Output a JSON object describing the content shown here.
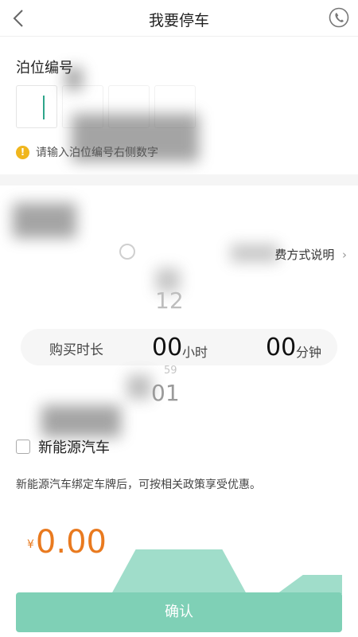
{
  "header": {
    "title": "我要停车",
    "back_icon": "chevron-left-icon",
    "phone_icon": "phone-icon"
  },
  "slot": {
    "label": "泊位编号",
    "hint": "请输入泊位编号右侧数字",
    "hint_icon": "warning-icon"
  },
  "time": {
    "fee_link": "费方式说明",
    "wheel_above": "12",
    "wheel_tiny": "59",
    "wheel_below": "01",
    "picker_label": "购买时长",
    "hours_value": "00",
    "hours_unit": "小时",
    "minutes_value": "00",
    "minutes_unit": "分钟"
  },
  "ev": {
    "label": "新能源汽车",
    "description": "新能源汽车绑定车牌后，可按相关政策享受优惠。",
    "checked": false
  },
  "price": {
    "symbol": "¥",
    "amount": "0.00"
  },
  "confirm": {
    "label": "确认"
  },
  "colors": {
    "accent_green": "#7fd0b6",
    "price_orange": "#e97a1f",
    "warning_yellow": "#f0b61d"
  }
}
